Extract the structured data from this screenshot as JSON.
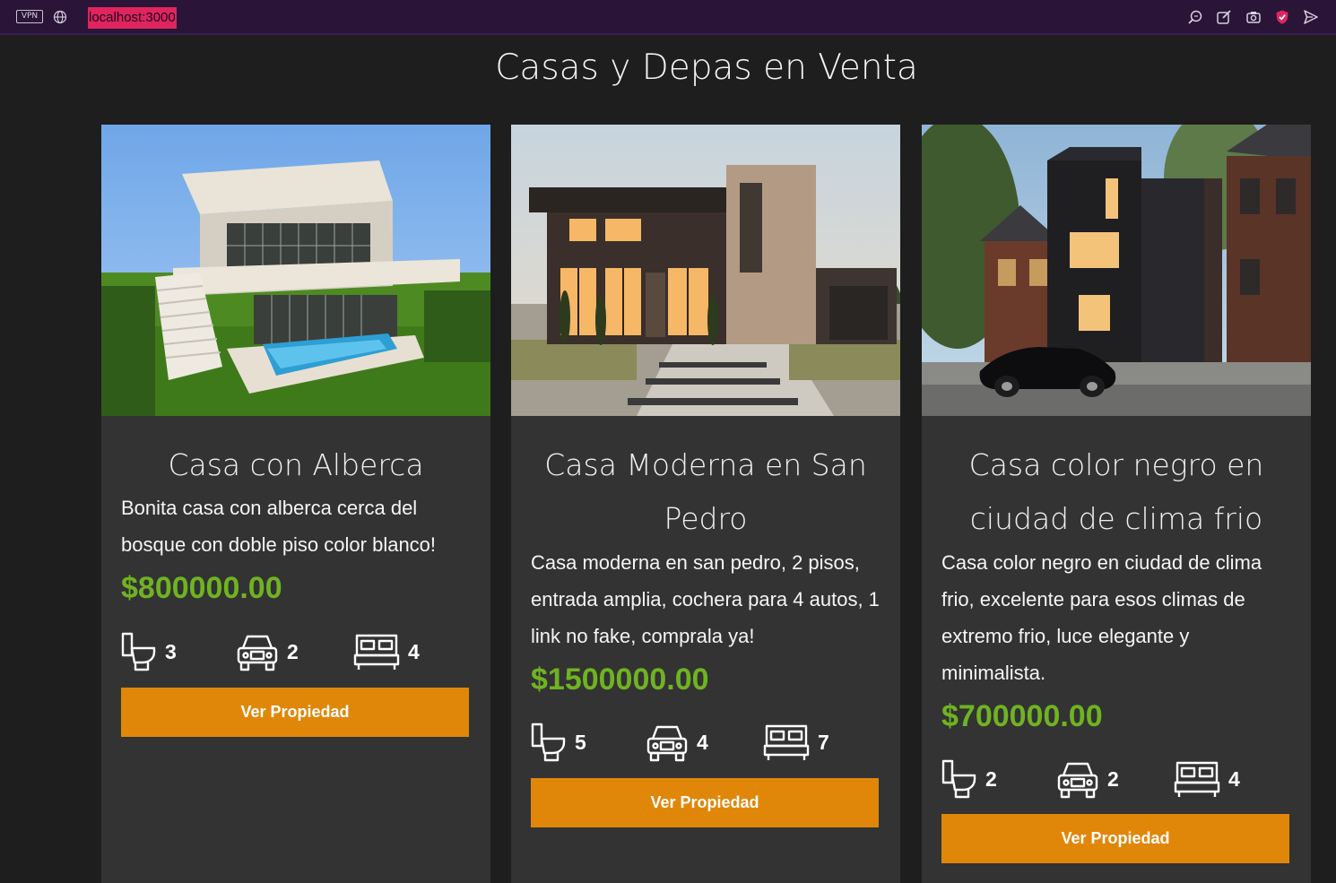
{
  "browser": {
    "vpn_label": "VPN",
    "url": "localhost:3000"
  },
  "page": {
    "title": "Casas y Depas en Venta"
  },
  "colors": {
    "price": "#6fb322",
    "button": "#e0870a",
    "card_bg": "#333333",
    "page_bg": "#1e1e1e",
    "browser_bar": "#2a1438"
  },
  "listings": [
    {
      "image_icon": "modern-white-house-with-pool-photo",
      "title": "Casa con Alberca",
      "description": "Bonita casa con alberca cerca del bosque con doble piso color blanco!",
      "price": "$800000.00",
      "baths": "3",
      "parking": "2",
      "bedrooms": "4",
      "button_label": "Ver Propiedad"
    },
    {
      "image_icon": "modern-house-at-dusk-photo",
      "title": "Casa Moderna en San Pedro",
      "description": "Casa moderna en san pedro, 2 pisos, entrada amplia, cochera para 4 autos, 1 link no fake, comprala ya!",
      "price": "$1500000.00",
      "baths": "5",
      "parking": "4",
      "bedrooms": "7",
      "button_label": "Ver Propiedad"
    },
    {
      "image_icon": "black-house-with-car-photo",
      "title": "Casa color negro en ciudad de clima frio",
      "description": "Casa color negro en ciudad de clima frio, excelente para esos climas de extremo frio, luce elegante y minimalista.",
      "price": "$700000.00",
      "baths": "2",
      "parking": "2",
      "bedrooms": "4",
      "button_label": "Ver Propiedad"
    }
  ]
}
